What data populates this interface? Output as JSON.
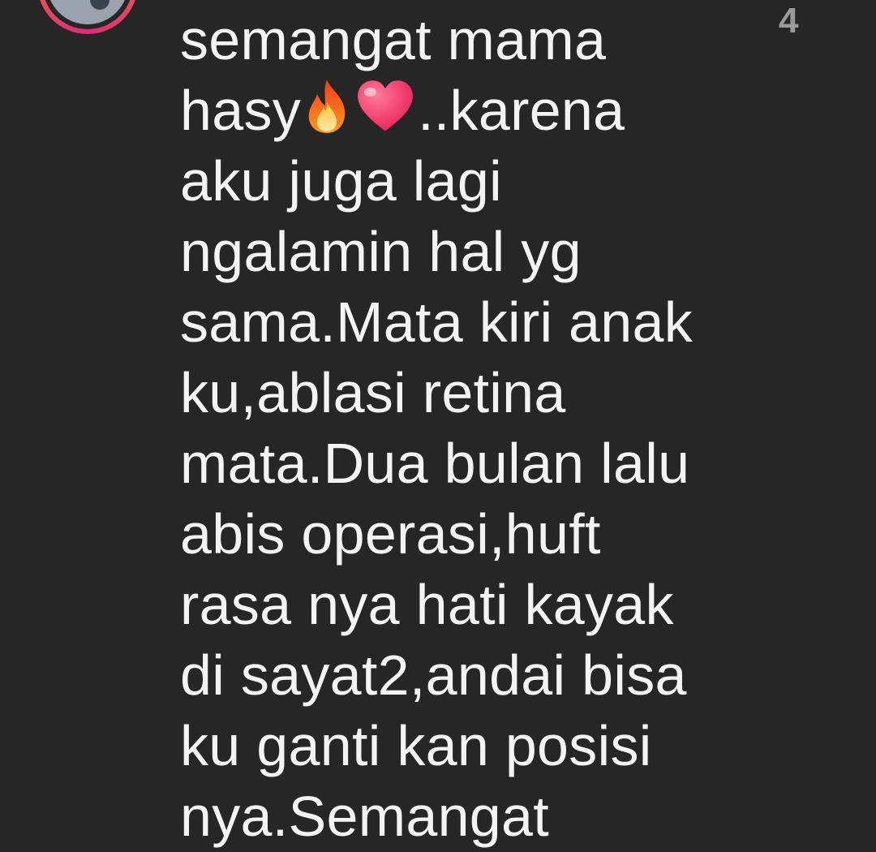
{
  "comment": {
    "lines": [
      "semangat mama",
      "hasy",
      "..karena",
      "aku juga lagi",
      "ngalamin hal yg",
      "sama.Mata kiri anak",
      "ku,ablasi retina",
      "mata.Dua bulan lalu",
      "abis operasi,huft",
      "rasa nya hati kayak",
      "di sayat2,andai bisa",
      "ku ganti kan posisi",
      "nya.Semangat"
    ],
    "emojis": [
      "fire-emoji",
      "heart-emoji"
    ],
    "like_count": "4"
  },
  "colors": {
    "background": "#262626",
    "text": "#f3f3f3",
    "muted": "#9a9a9a",
    "avatar_ring_start": "#f58529",
    "avatar_ring_end": "#dd2a7b"
  }
}
